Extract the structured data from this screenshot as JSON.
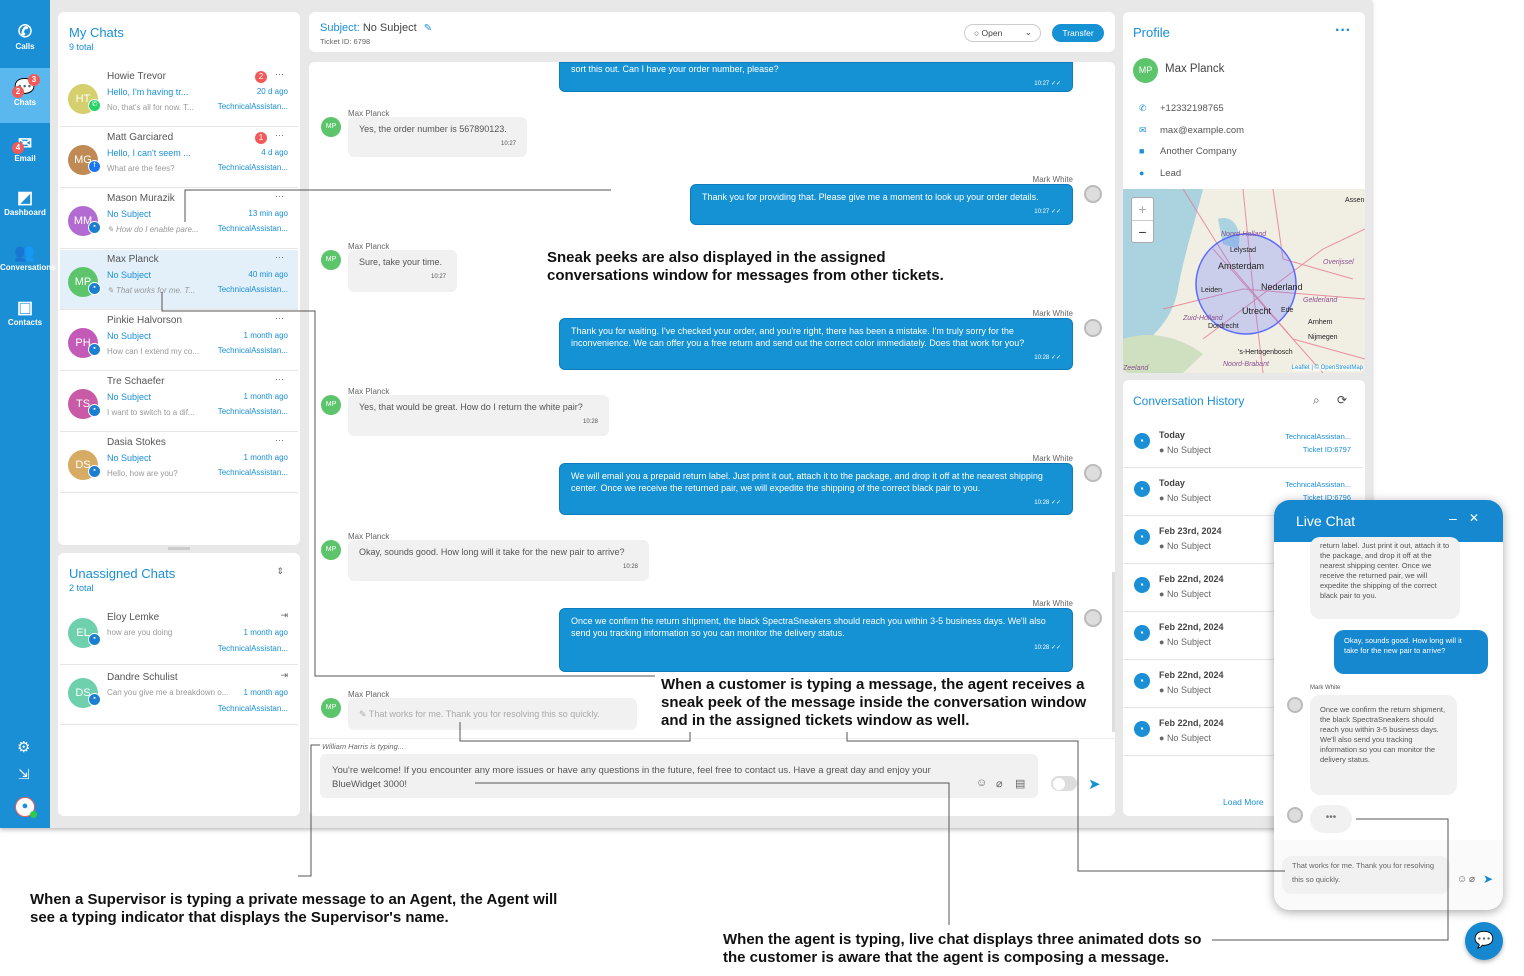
{
  "colors": {
    "accent": "#1a8fd6",
    "badge": "#f25a5a",
    "agent_bubble": "#1592d4"
  },
  "nav": [
    {
      "label": "Calls",
      "icon": "phone-icon"
    },
    {
      "label": "Chats",
      "icon": "chat-icon",
      "badges": [
        "2",
        "3"
      ]
    },
    {
      "label": "Email",
      "icon": "email-icon",
      "badges": [
        "4"
      ]
    },
    {
      "label": "Dashboard",
      "icon": "dashboard-icon"
    },
    {
      "label": "Conversations",
      "icon": "people-icon"
    },
    {
      "label": "Contacts",
      "icon": "contact-icon"
    }
  ],
  "my_chats": {
    "title": "My Chats",
    "total": "9 total",
    "items": [
      {
        "initials": "HT",
        "name": "Howie Trevor",
        "subject": "Hello, I'm having tr...",
        "preview": "No, that's all for now. T...",
        "time": "20 d ago",
        "queue": "TechnicalAssistan...",
        "unread": "2",
        "channel": "whatsapp",
        "color": "#d5cf6e"
      },
      {
        "initials": "MG",
        "name": "Matt Garciared",
        "subject": "Hello, I can't seem ...",
        "preview": "What are the fees?",
        "time": "4 d ago",
        "queue": "TechnicalAssistan...",
        "unread": "1",
        "channel": "facebook",
        "color": "#c08a55"
      },
      {
        "initials": "MM",
        "name": "Mason Murazik",
        "subject": "No Subject",
        "preview": "How do I enable pare...",
        "time": "13 min ago",
        "queue": "TechnicalAssistan...",
        "channel": "chat",
        "color": "#b26bd1",
        "typing": true
      },
      {
        "initials": "MP",
        "name": "Max Planck",
        "subject": "No Subject",
        "preview": "That works for me. T...",
        "time": "40 min ago",
        "queue": "TechnicalAssistan...",
        "channel": "chat",
        "color": "#5cc56b",
        "typing": true
      },
      {
        "initials": "PH",
        "name": "Pinkie Halvorson",
        "subject": "No Subject",
        "preview": "How can I extend my co...",
        "time": "1 month ago",
        "queue": "TechnicalAssistan...",
        "channel": "chat",
        "color": "#c45ab8"
      },
      {
        "initials": "TS",
        "name": "Tre Schaefer",
        "subject": "No Subject",
        "preview": "I want to switch to a dif...",
        "time": "1 month ago",
        "queue": "TechnicalAssistan...",
        "channel": "chat",
        "color": "#c95aa6"
      },
      {
        "initials": "DS",
        "name": "Dasia Stokes",
        "subject": "No Subject",
        "preview": "Hello, how are you?",
        "time": "1 month ago",
        "queue": "TechnicalAssistan...",
        "channel": "chat",
        "color": "#d6ab63"
      }
    ]
  },
  "unassigned": {
    "title": "Unassigned Chats",
    "total": "2 total",
    "items": [
      {
        "initials": "EL",
        "name": "Eloy Lemke",
        "preview": "how are you doing",
        "time": "1 month ago",
        "queue": "TechnicalAssistan...",
        "color": "#6fd0ae"
      },
      {
        "initials": "DS",
        "name": "Dandre Schulist",
        "preview": "Can you give me a breakdown o...",
        "time": "1 month ago",
        "queue": "TechnicalAssistan...",
        "color": "#6fd0ae"
      }
    ]
  },
  "header": {
    "subject_label": "Subject:",
    "subject": "No Subject",
    "ticket": "Ticket ID: 6798",
    "status": "Open",
    "transfer": "Transfer"
  },
  "messages": [
    {
      "from": "agent",
      "text": "sort this out. Can I have your order number, please?",
      "time": "10:27"
    },
    {
      "from": "customer",
      "name": "Max Planck",
      "text": "Yes, the order number is 567890123.",
      "time": "10:27"
    },
    {
      "from": "agent",
      "name": "Mark White",
      "text": "Thank you for providing that. Please give me a moment to look up your order details.",
      "time": "10:27"
    },
    {
      "from": "customer",
      "name": "Max Planck",
      "text": "Sure, take your time.",
      "time": "10:27"
    },
    {
      "from": "agent",
      "name": "Mark White",
      "text": "Thank you for waiting. I've checked your order, and you're right, there has been a mistake. I'm truly sorry for the inconvenience. We can offer you a free return and send out the correct color immediately. Does that work for you?",
      "time": "10:28"
    },
    {
      "from": "customer",
      "name": "Max Planck",
      "text": "Yes, that would be great. How do I return the white pair?",
      "time": "10:28"
    },
    {
      "from": "agent",
      "name": "Mark White",
      "text": "We will email you a prepaid return label. Just print it out, attach it to the package, and drop it off at the nearest shipping center. Once we receive the returned pair, we will expedite the shipping of the correct black pair to you.",
      "time": "10:28"
    },
    {
      "from": "customer",
      "name": "Max Planck",
      "text": "Okay, sounds good. How long will it take for the new pair to arrive?",
      "time": "10:28"
    },
    {
      "from": "agent",
      "name": "Mark White",
      "text": "Once we confirm the return shipment, the black SpectraSneakers should reach you within 3-5 business days. We'll also send you tracking information so you can monitor the delivery status.",
      "time": "10:28"
    },
    {
      "from": "customer",
      "name": "Max Planck",
      "text": "That works for me. Thank you for resolving this so quickly.",
      "sneak_peek": true
    }
  ],
  "composer": {
    "typing": "William Harris is typing...",
    "text": "You're welcome! If you encounter any more issues or have any questions in the future, feel free to contact us. Have a great day and enjoy your BlueWidget 3000!"
  },
  "profile": {
    "title": "Profile",
    "initials": "MP",
    "name": "Max Planck",
    "phone": "+12332198765",
    "email": "max@example.com",
    "company": "Another Company",
    "type": "Lead"
  },
  "map": {
    "labels": [
      "Noord-Holland",
      "Amsterdam",
      "Lelystad",
      "Leiden",
      "Nederland",
      "Utrecht",
      "Zuid-Holland",
      "Dordrecht",
      "Gelderland",
      "Overijssel",
      "Arnhem",
      "Nijmegen",
      "'s-Hertogenbosch",
      "Noord-Brabant",
      "Zeeland",
      "Assen",
      "Ede"
    ],
    "attribution": "Leaflet | © OpenStreetMap",
    "zoom_in": "+",
    "zoom_out": "−"
  },
  "history": {
    "title": "Conversation History",
    "load_more": "Load More",
    "items": [
      {
        "date": "Today",
        "subject": "No Subject",
        "queue": "TechnicalAssistan...",
        "ticket": "Ticket ID:6797"
      },
      {
        "date": "Today",
        "subject": "No Subject",
        "queue": "TechnicalAssistan...",
        "ticket": "Ticket ID:6796"
      },
      {
        "date": "Feb 23rd, 2024",
        "subject": "No Subject"
      },
      {
        "date": "Feb 22nd, 2024",
        "subject": "No Subject"
      },
      {
        "date": "Feb 22nd, 2024",
        "subject": "No Subject"
      },
      {
        "date": "Feb 22nd, 2024",
        "subject": "No Subject"
      },
      {
        "date": "Feb 22nd, 2024",
        "subject": "No Subject"
      }
    ]
  },
  "live_chat": {
    "title": "Live Chat",
    "m1": "return label. Just print it out, attach it to the package, and drop it off at the nearest shipping center. Once we receive the returned pair, we will expedite the shipping of the correct black pair to you.",
    "m2": "Okay, sounds good. How long will it take for the new pair to arrive?",
    "agent": "Mark White",
    "m3": "Once we confirm the return shipment, the black SpectraSneakers should reach you within 3-5 business days. We'll also send you tracking information so you can monitor the delivery status.",
    "input": "That works for me. Thank you for resolving this so quickly."
  },
  "annotations": {
    "a1": "Sneak peeks are also displayed in the assigned conversations window for messages from other tickets.",
    "a2": "When a customer is typing a message, the agent receives a sneak peek of the message inside the conversation window and in the assigned tickets window as well.",
    "a3": "When a Supervisor is typing a private message to an Agent, the Agent will see a typing indicator that displays the Supervisor's name.",
    "a4": "When the agent is typing, live chat displays three animated dots so the customer is aware that the agent is composing a message."
  }
}
